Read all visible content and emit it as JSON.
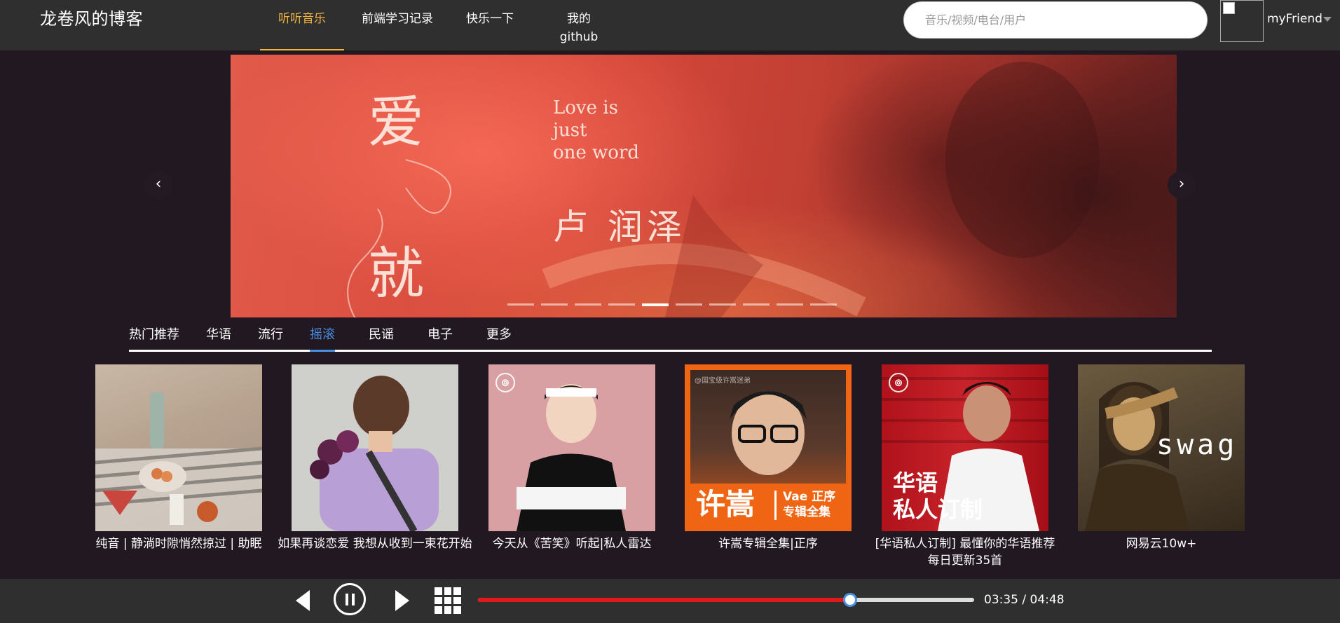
{
  "site": {
    "title": "龙卷风的博客"
  },
  "nav": {
    "items": [
      {
        "label": "听听音乐",
        "active": true
      },
      {
        "label": "前端学习记录",
        "active": false
      },
      {
        "label": "快乐一下",
        "active": false
      },
      {
        "label": "我的github",
        "active": false
      }
    ]
  },
  "search": {
    "placeholder": "音乐/视频/电台/用户",
    "value": ""
  },
  "user": {
    "name": "myFriend"
  },
  "banner": {
    "text_ai": "爱",
    "text_jiu": "就",
    "love_lines": [
      "Love is",
      "just",
      "one word"
    ],
    "artist": "卢 润泽",
    "slide_count": 10,
    "active_slide": 4,
    "prev_symbol": "‹",
    "next_symbol": "›"
  },
  "tabs": {
    "items": [
      {
        "label": "热门推荐",
        "active": false
      },
      {
        "label": "华语",
        "active": false
      },
      {
        "label": "流行",
        "active": false
      },
      {
        "label": "摇滚",
        "active": true
      },
      {
        "label": "民谣",
        "active": false
      },
      {
        "label": "电子",
        "active": false
      },
      {
        "label": "更多",
        "active": false
      }
    ]
  },
  "playlists": [
    {
      "title": "纯音 | 静淌时隙悄然掠过 | 助眠",
      "cover_text": ""
    },
    {
      "title": "如果再谈恋爱 我想从收到一束花开始",
      "cover_text": ""
    },
    {
      "title": "今天从《苦笑》听起|私人雷达",
      "cover_text": ""
    },
    {
      "title": "许嵩专辑全集|正序",
      "cover_text": "许嵩",
      "cover_sub": [
        "Vae 正序",
        "专辑全集"
      ],
      "cover_corner": "@国宝级许嵩迷弟"
    },
    {
      "title": "[华语私人订制] 最懂你的华语推荐 每日更新35首",
      "cover_text": "华语\n私人订制"
    },
    {
      "title": "网易云10w+",
      "cover_text": "swag"
    }
  ],
  "player": {
    "current_time": "03:35",
    "total_time": "04:48",
    "time_display": "03:35 / 04:48",
    "progress_fraction": 0.75,
    "accent_color": "#e21918",
    "knob_color": "#4a90e2"
  },
  "colors": {
    "header_bg": "#2f2f2f",
    "page_bg": "#211821",
    "nav_active": "#f2b640",
    "tab_active": "#4a90e2"
  },
  "icons": {
    "prev": "triangle-left-icon",
    "pause": "pause-circle-icon",
    "next": "triangle-right-icon",
    "playlist": "grid-icon",
    "netease": "netease-logo-icon"
  }
}
